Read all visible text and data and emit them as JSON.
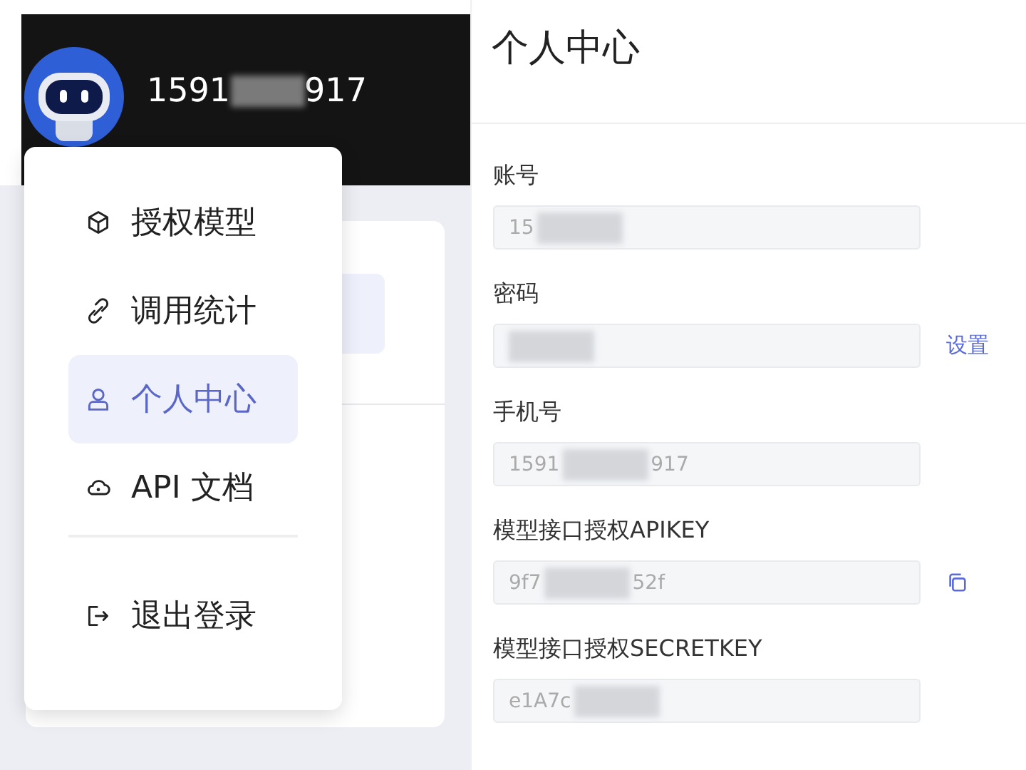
{
  "header": {
    "username_start": "1591",
    "username_end": "917",
    "redacted": true
  },
  "menu": {
    "items": [
      {
        "label": "授权模型",
        "kind": "cube",
        "selected": false
      },
      {
        "label": "调用统计",
        "kind": "link",
        "selected": false
      },
      {
        "label": "个人中心",
        "kind": "user",
        "selected": true
      },
      {
        "label": "API 文档",
        "kind": "cloud",
        "selected": false
      },
      {
        "label": "退出登录",
        "kind": "logout",
        "selected": false,
        "divider_before": true
      }
    ]
  },
  "profile": {
    "title": "个人中心",
    "fields": [
      {
        "label": "账号",
        "value_start": "15",
        "redacted": true
      },
      {
        "label": "密码",
        "redacted": true,
        "action": {
          "kind": "link",
          "text": "设置"
        }
      },
      {
        "label": "手机号",
        "value_start": "1591",
        "value_end": "917",
        "redacted": true
      },
      {
        "label": "模型接口授权APIKEY",
        "value_start": "9f7",
        "value_end": "52f",
        "redacted": true,
        "action": {
          "kind": "copy"
        }
      },
      {
        "label": "模型接口授权SECRETKEY",
        "value_start": "e1A7c",
        "redacted": true
      }
    ]
  }
}
